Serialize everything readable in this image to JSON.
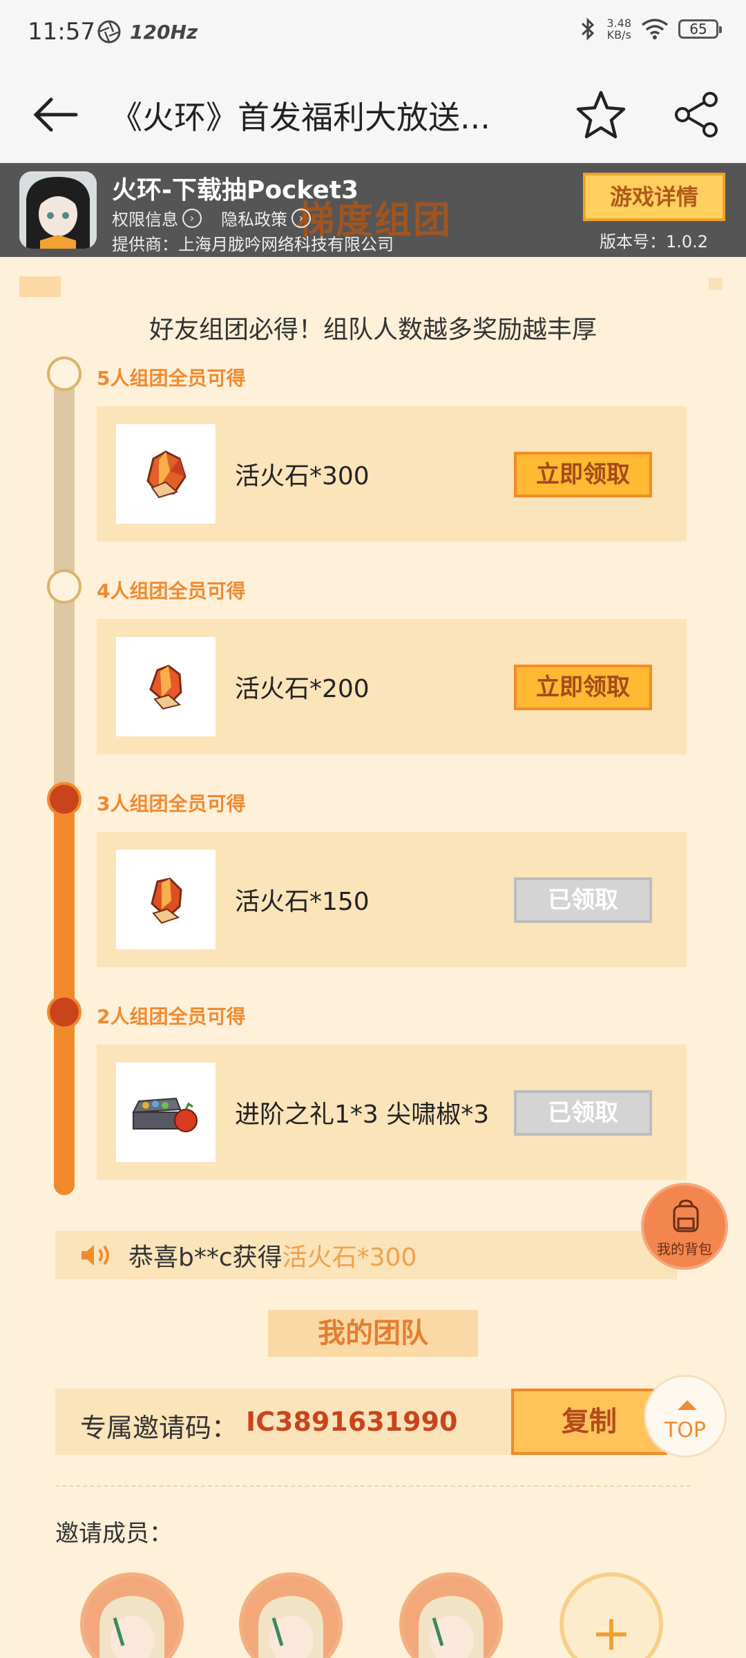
{
  "status_bar": {
    "time": "11:57",
    "refresh_rate": "120Hz",
    "net_speed_value": "3.48",
    "net_speed_unit": "KB/s",
    "battery": "65"
  },
  "header": {
    "title": "《火环》首发福利大放送..."
  },
  "game": {
    "name": "火环-下载抽Pocket3",
    "permission_info": "权限信息",
    "privacy_policy": "隐私政策",
    "provider": "提供商：上海月胧吟网络科技有限公司",
    "detail_button": "游戏详情",
    "version": "版本号：1.0.2",
    "banner_bg_title": "梯度组团"
  },
  "tagline": "好友组团必得！组队人数越多奖励越丰厚",
  "tiers": [
    {
      "label": "5人组团全员可得",
      "reward": "活火石*300",
      "button": "立即领取",
      "status": "open"
    },
    {
      "label": "4人组团全员可得",
      "reward": "活火石*200",
      "button": "立即领取",
      "status": "open"
    },
    {
      "label": "3人组团全员可得",
      "reward": "活火石*150",
      "button": "已领取",
      "status": "claimed"
    },
    {
      "label": "2人组团全员可得",
      "reward": "进阶之礼1*3   尖啸椒*3",
      "button": "已领取",
      "status": "claimed"
    }
  ],
  "broadcast": {
    "text": "恭喜b**c获得",
    "prize": "活火石*300"
  },
  "team": {
    "title": "我的团队",
    "invite_label": "专属邀请码：",
    "invite_code": "IC3891631990",
    "copy_button": "复制",
    "members_label": "邀请成员："
  },
  "floating": {
    "backpack": "我的背包",
    "top": "TOP"
  },
  "colors": {
    "accent": "#f28a2c",
    "background": "#fdf1dc",
    "claimed": "#d4d4d4"
  }
}
